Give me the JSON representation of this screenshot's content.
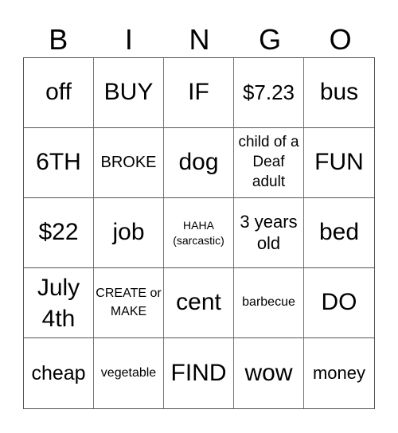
{
  "header": {
    "letters": [
      "B",
      "I",
      "N",
      "G",
      "O"
    ]
  },
  "grid": {
    "rows": [
      [
        "off",
        "BUY",
        "IF",
        "$7.23",
        "bus"
      ],
      [
        "6TH",
        "BROKE",
        "dog",
        "child of a Deaf adult",
        "FUN"
      ],
      [
        "$22",
        "job",
        "HAHA (sarcastic)",
        "3 years old",
        "bed"
      ],
      [
        "July 4th",
        "CREATE or MAKE",
        "cent",
        "barbecue",
        "DO"
      ],
      [
        "cheap",
        "vegetable",
        "FIND",
        "wow",
        "money"
      ]
    ]
  }
}
